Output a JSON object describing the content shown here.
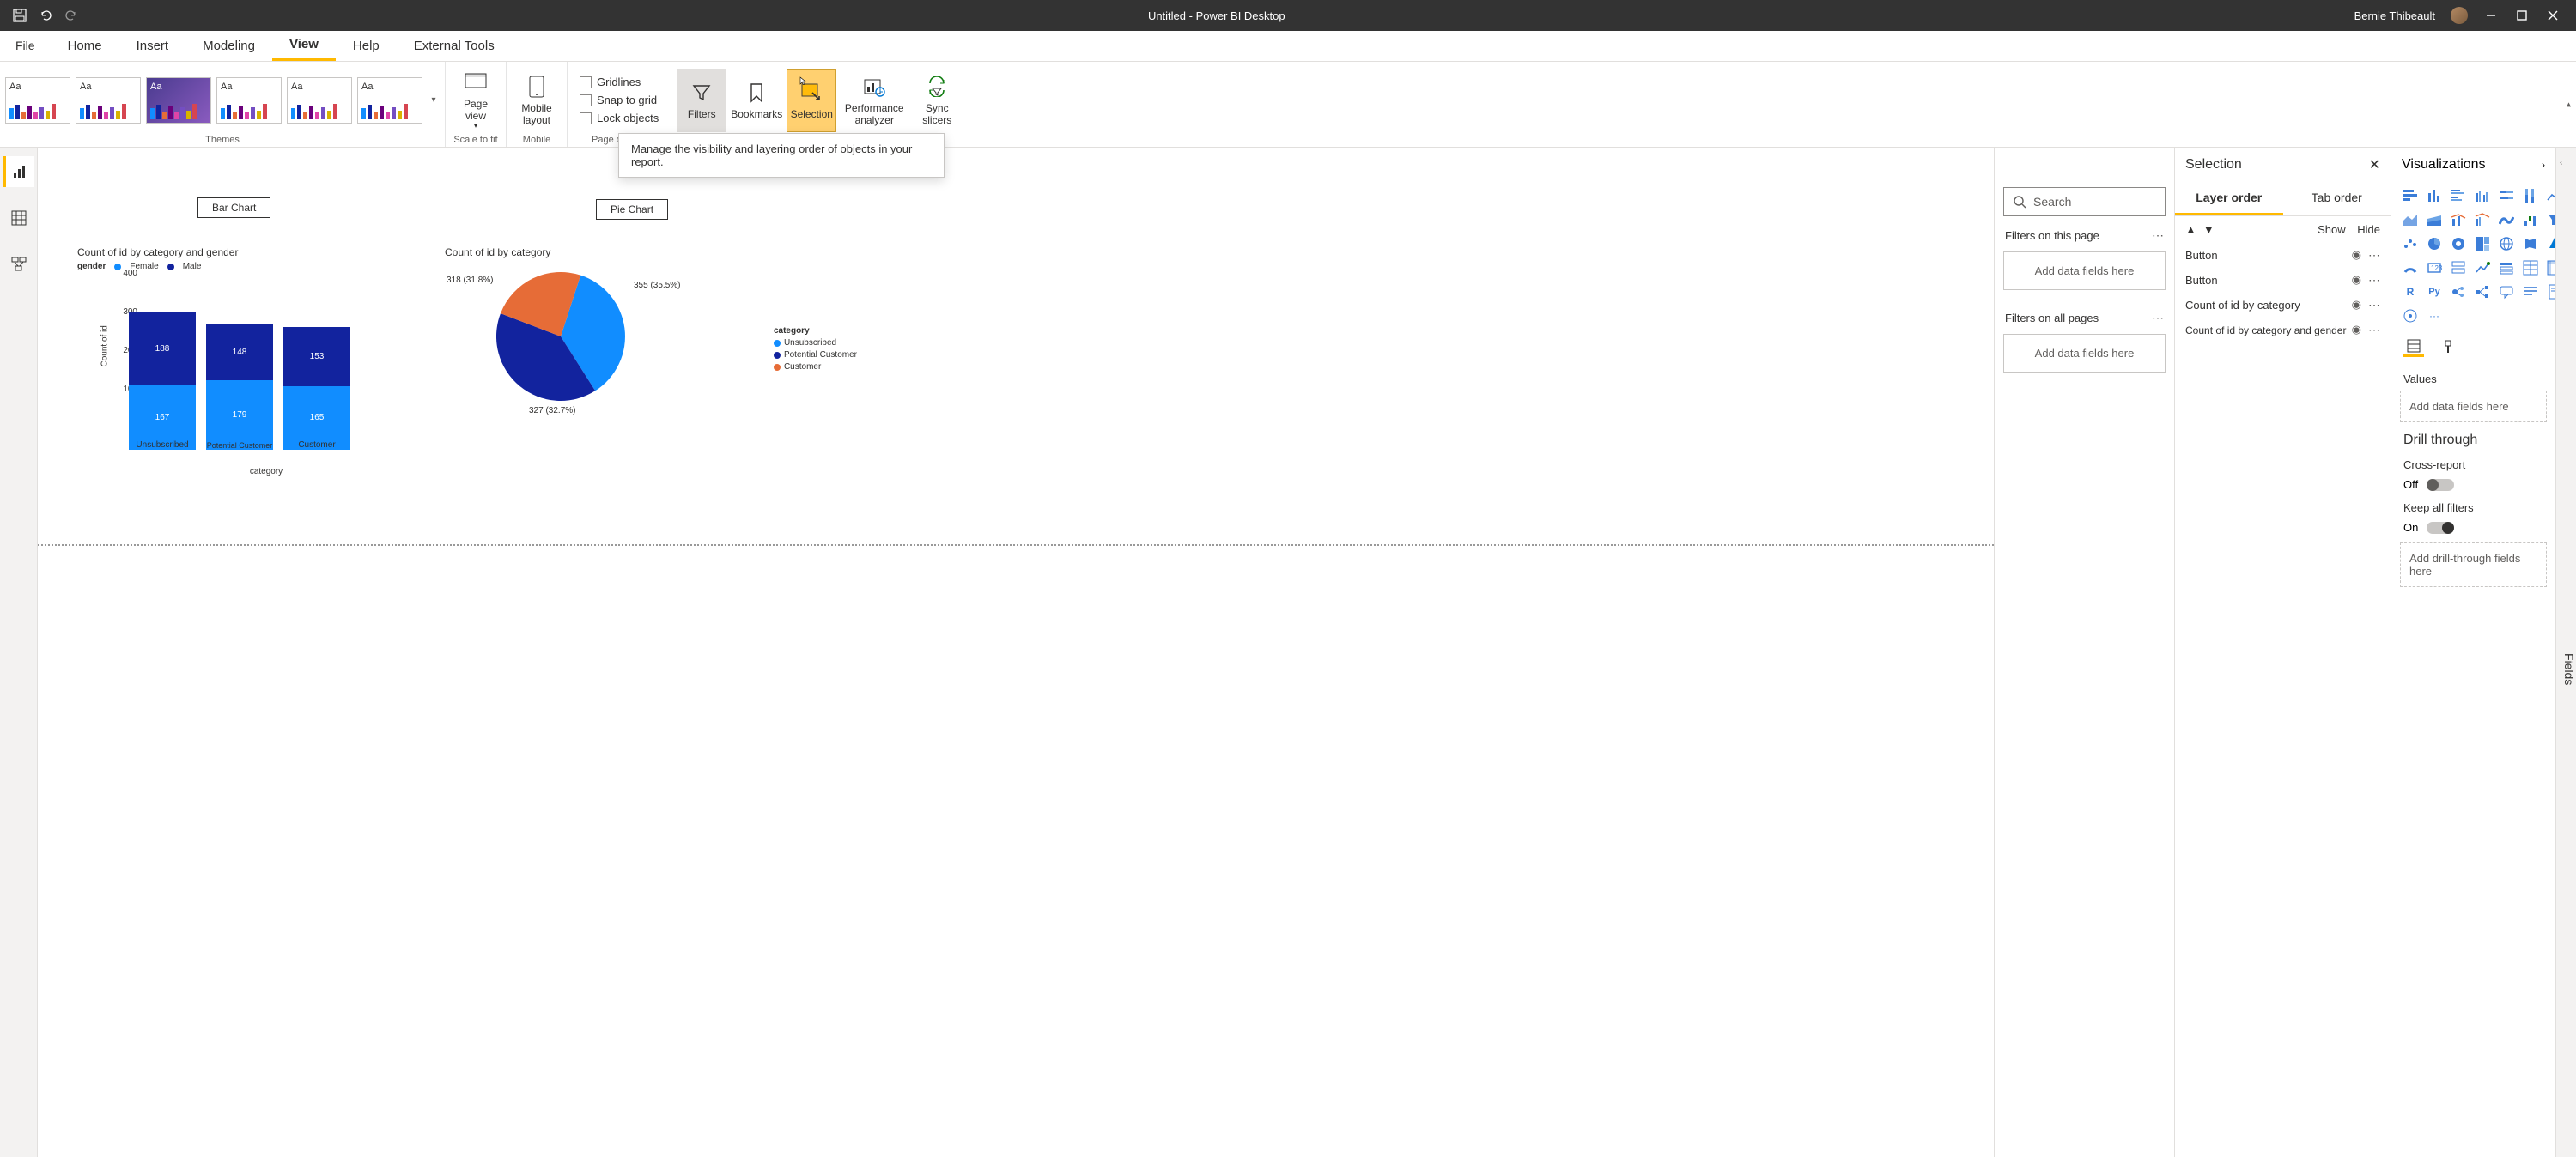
{
  "titlebar": {
    "title": "Untitled - Power BI Desktop",
    "user": "Bernie Thibeault"
  },
  "tabs": {
    "file": "File",
    "home": "Home",
    "insert": "Insert",
    "modeling": "Modeling",
    "view": "View",
    "help": "Help",
    "external": "External Tools"
  },
  "ribbon": {
    "themes_label": "Themes",
    "theme_sample": "Aa",
    "scale_label": "Scale to fit",
    "page_view": "Page view",
    "mobile_label": "Mobile",
    "mobile_layout": "Mobile layout",
    "page_options_label": "Page options",
    "gridlines": "Gridlines",
    "snap": "Snap to grid",
    "lock": "Lock objects",
    "filters": "Filters",
    "bookmarks": "Bookmarks",
    "selection": "Selection",
    "performance": "Performance analyzer",
    "sync": "Sync slicers"
  },
  "tooltip": "Manage the visibility and layering order of objects in your report.",
  "canvas": {
    "bar_btn": "Bar Chart",
    "pie_btn": "Pie Chart",
    "bar_title": "Count of id by category and gender",
    "pie_title": "Count of id by category",
    "legend_title": "gender",
    "legend_female": "Female",
    "legend_male": "Male",
    "axis_y": "Count of id",
    "axis_x": "category",
    "pie_legend_title": "category",
    "pie_legend": [
      "Unsubscribed",
      "Potential Customer",
      "Customer"
    ]
  },
  "chart_data": [
    {
      "type": "bar",
      "title": "Count of id by category and gender",
      "xlabel": "category",
      "ylabel": "Count of id",
      "ylim": [
        0,
        400
      ],
      "yticks": [
        0,
        100,
        200,
        300,
        400
      ],
      "categories": [
        "Unsubscribed",
        "Potential Customer",
        "Customer"
      ],
      "series": [
        {
          "name": "Female",
          "color": "#118dff",
          "values": [
            167,
            179,
            165
          ]
        },
        {
          "name": "Male",
          "color": "#12239e",
          "values": [
            188,
            148,
            153
          ]
        }
      ]
    },
    {
      "type": "pie",
      "title": "Count of id by category",
      "slices": [
        {
          "name": "Unsubscribed",
          "value": 355,
          "pct": 35.5,
          "color": "#118dff",
          "label": "355 (35.5%)"
        },
        {
          "name": "Potential Customer",
          "value": 327,
          "pct": 32.7,
          "color": "#12239e",
          "label": "327 (32.7%)"
        },
        {
          "name": "Customer",
          "value": 318,
          "pct": 31.8,
          "color": "#e66c37",
          "label": "318 (31.8%)"
        }
      ]
    }
  ],
  "filters": {
    "search_placeholder": "Search",
    "on_page": "Filters on this page",
    "on_all": "Filters on all pages",
    "add_fields": "Add data fields here"
  },
  "selection": {
    "title": "Selection",
    "layer_tab": "Layer order",
    "taborder_tab": "Tab order",
    "show": "Show",
    "hide": "Hide",
    "items": [
      "Button",
      "Button",
      "Count of id by category",
      "Count of id by category and gender"
    ]
  },
  "viz": {
    "title": "Visualizations",
    "values": "Values",
    "add_fields": "Add data fields here",
    "drill": "Drill through",
    "cross": "Cross-report",
    "off": "Off",
    "keep": "Keep all filters",
    "on": "On",
    "add_drill": "Add drill-through fields here",
    "r_label": "R",
    "py_label": "Py",
    "more": "···"
  },
  "fields": {
    "label": "Fields"
  }
}
